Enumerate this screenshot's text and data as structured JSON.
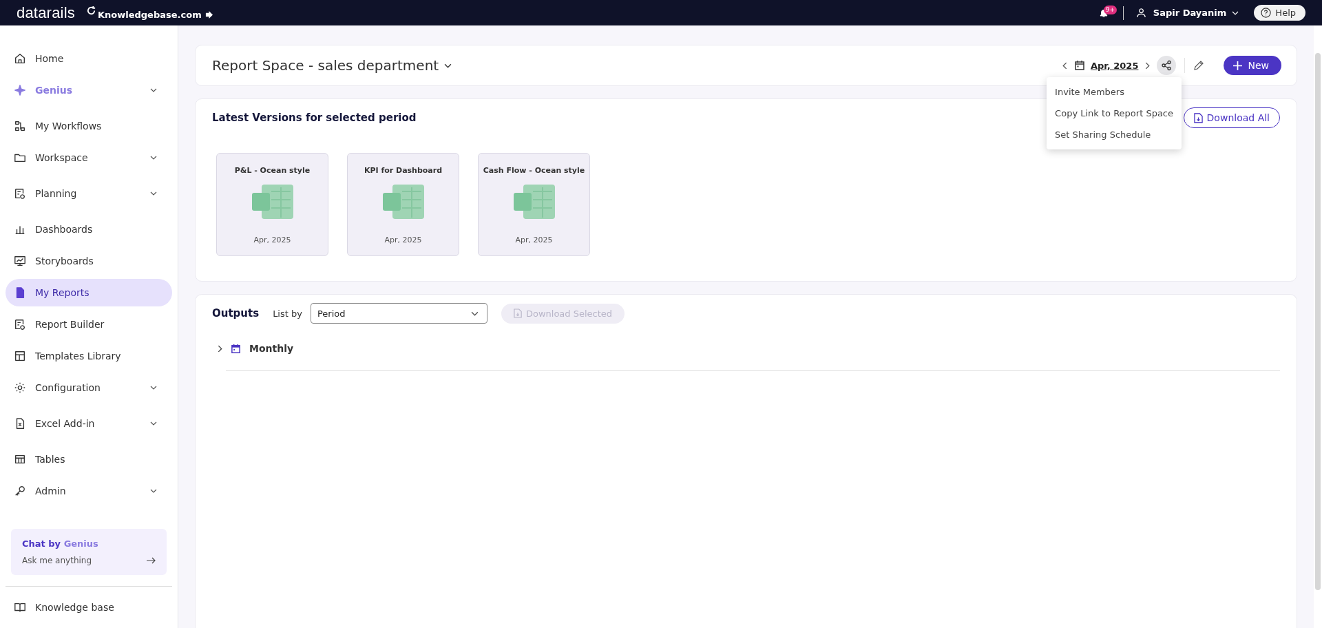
{
  "top_bar": {
    "logo": "datarails",
    "site": "Knowledgebase.com",
    "notifications": "9+",
    "user": "Sapir Dayanim",
    "help": "Help"
  },
  "sidebar": {
    "items": [
      {
        "label": "Home",
        "kind": "plain",
        "selected": false,
        "has_submenu": false
      },
      {
        "label": "Genius",
        "kind": "genius",
        "selected": false,
        "has_submenu": true
      },
      {
        "label": "My Workflows",
        "kind": "plain",
        "selected": false,
        "has_submenu": false
      },
      {
        "label": "Workspace",
        "kind": "plain",
        "selected": false,
        "has_submenu": true
      },
      {
        "label": "Planning",
        "kind": "plain",
        "selected": false,
        "has_submenu": true
      },
      {
        "label": "Dashboards",
        "kind": "plain",
        "selected": false,
        "has_submenu": false
      },
      {
        "label": "Storyboards",
        "kind": "plain",
        "selected": false,
        "has_submenu": false
      },
      {
        "label": "My Reports",
        "kind": "plain",
        "selected": true,
        "has_submenu": false
      },
      {
        "label": "Report Builder",
        "kind": "plain",
        "selected": false,
        "has_submenu": false
      },
      {
        "label": "Templates Library",
        "kind": "plain",
        "selected": false,
        "has_submenu": false
      },
      {
        "label": "Configuration",
        "kind": "plain",
        "selected": false,
        "has_submenu": true
      },
      {
        "label": "Excel Add-in",
        "kind": "plain",
        "selected": false,
        "has_submenu": true
      },
      {
        "label": "Tables",
        "kind": "plain",
        "selected": false,
        "has_submenu": false
      },
      {
        "label": "Admin",
        "kind": "plain",
        "selected": false,
        "has_submenu": true
      }
    ],
    "chat": {
      "title_prefix": "Chat by",
      "title_brand": "Genius",
      "prompt": "Ask me anything"
    },
    "footer": {
      "label": "Knowledge base"
    }
  },
  "header": {
    "title": "Report Space - sales department",
    "period": "Apr, 2025",
    "new_button": "New",
    "share_active": true
  },
  "share_menu": {
    "items": [
      "Invite Members",
      "Copy Link to Report Space",
      "Set Sharing Schedule"
    ]
  },
  "latest": {
    "title": "Latest Versions for selected period",
    "download_all": "Download All",
    "cards": [
      {
        "title": "P&L - Ocean style",
        "period": "Apr, 2025"
      },
      {
        "title": "KPI for Dashboard",
        "period": "Apr, 2025"
      },
      {
        "title": "Cash Flow - Ocean style",
        "period": "Apr, 2025"
      }
    ]
  },
  "outputs": {
    "title": "Outputs",
    "list_by_label": "List by",
    "list_by_value": "Period",
    "download_selected": {
      "label": "Download Selected",
      "disabled": true
    },
    "groups": [
      {
        "label": "Monthly",
        "expanded": false
      }
    ]
  }
}
